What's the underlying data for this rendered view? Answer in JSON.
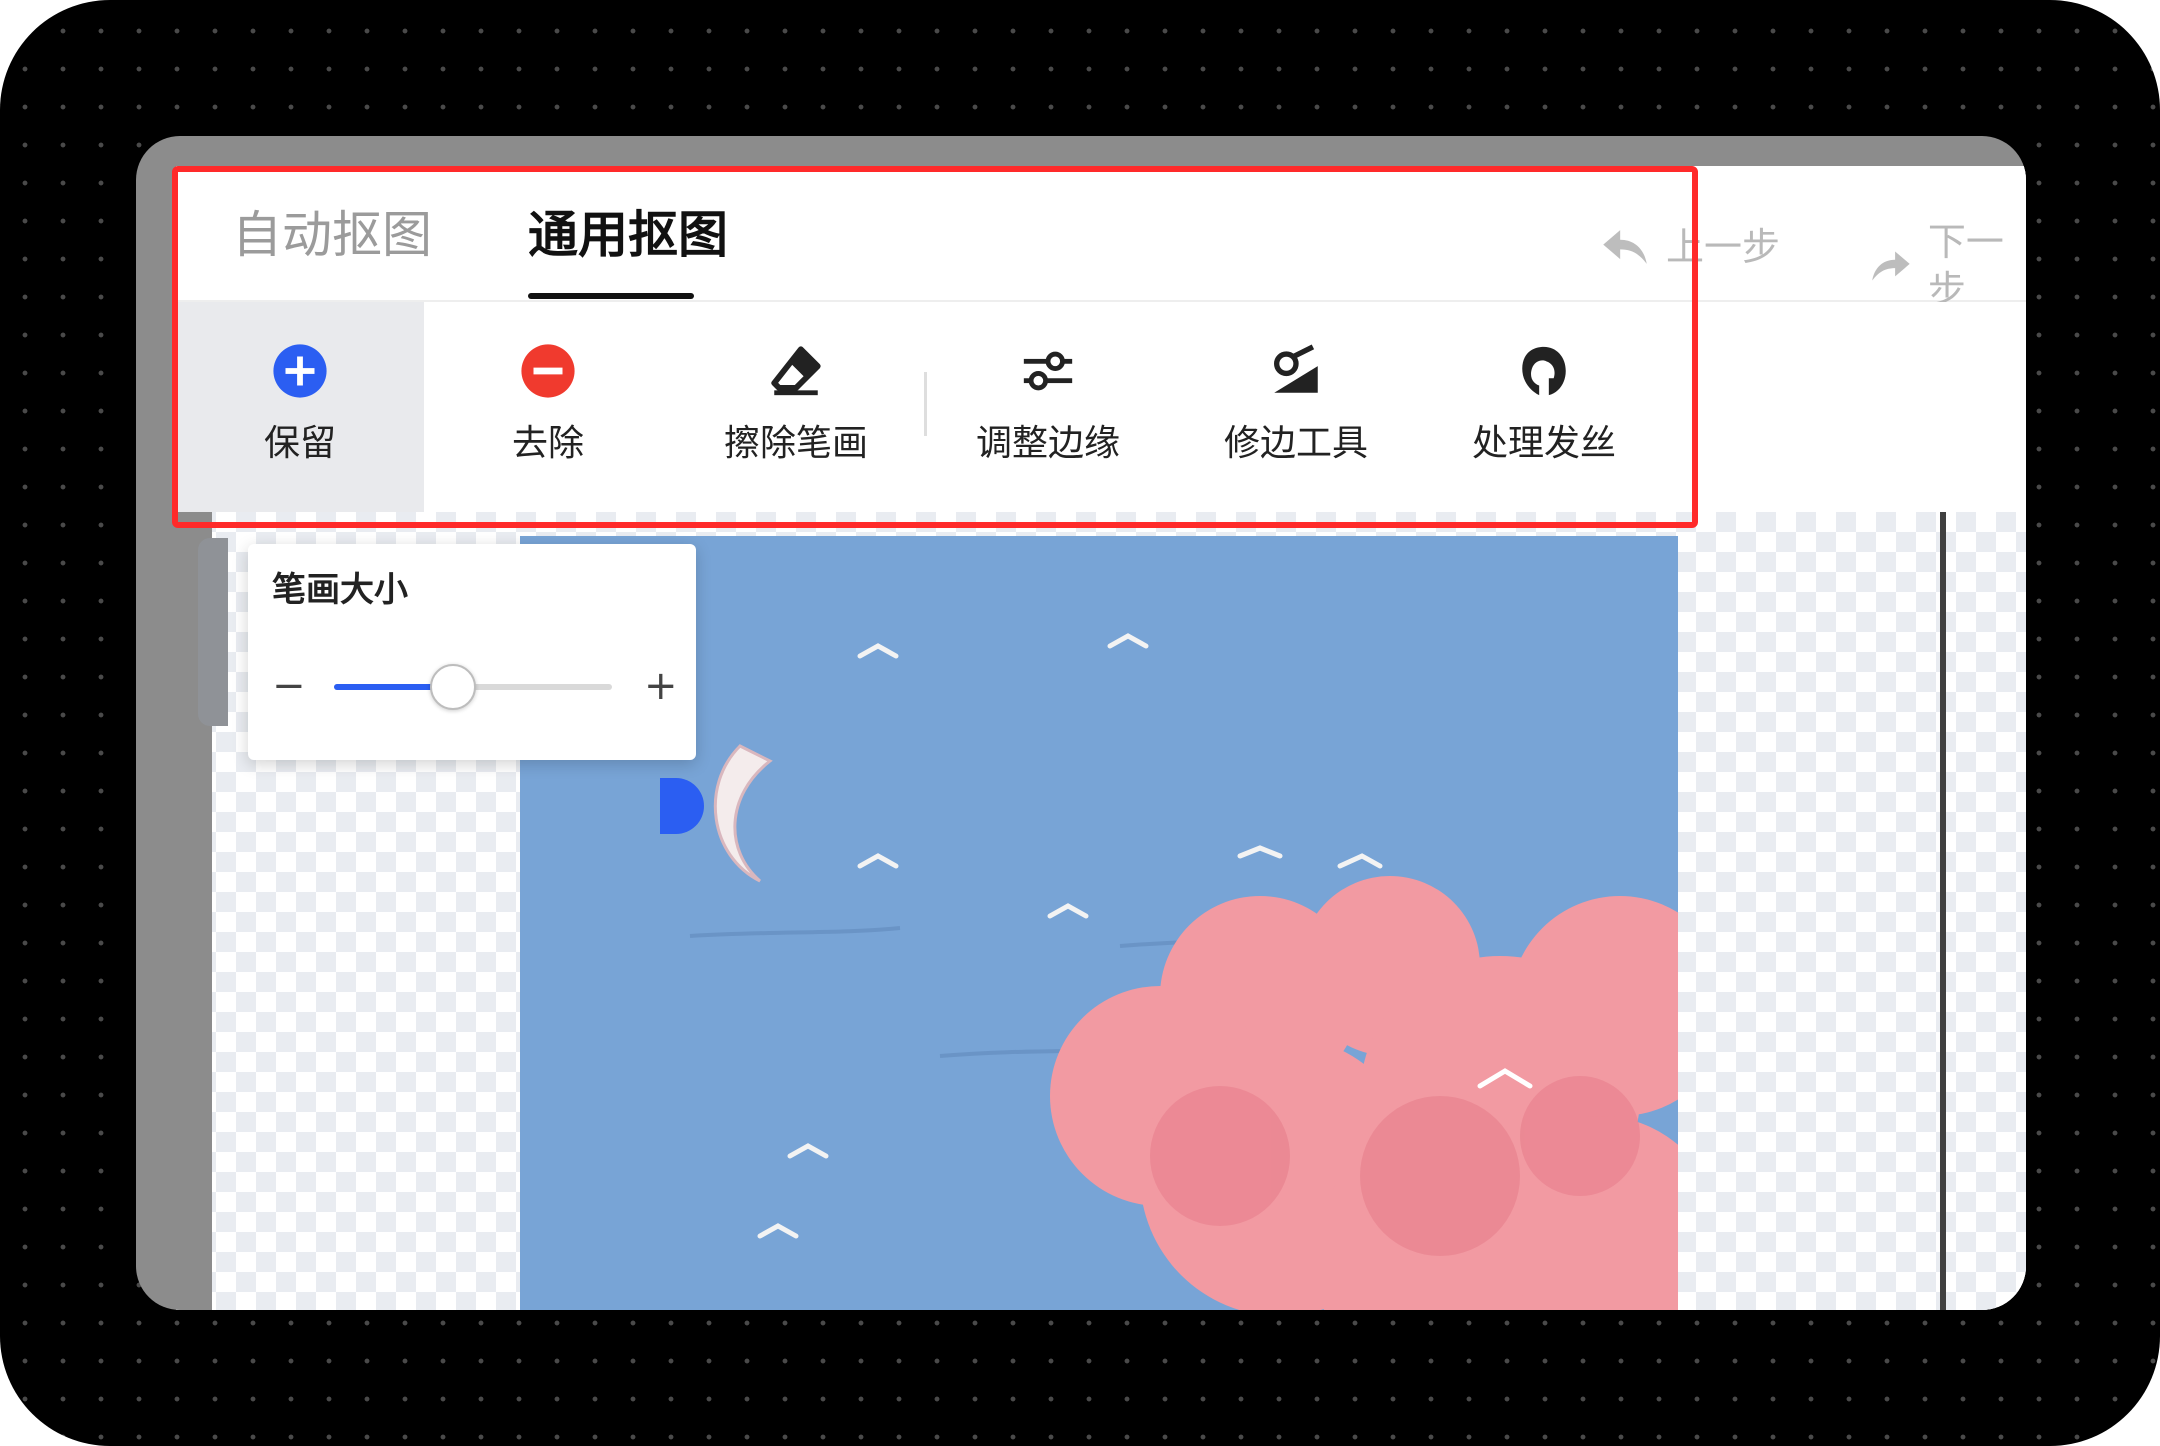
{
  "tabs": [
    {
      "label": "自动抠图",
      "active": false
    },
    {
      "label": "通用抠图",
      "active": true
    }
  ],
  "history": {
    "undo_label": "上一步",
    "redo_label": "下一步"
  },
  "tools": [
    {
      "label": "保留",
      "icon": "plus-circle-icon",
      "color": "#2b5ef2",
      "active": true
    },
    {
      "label": "去除",
      "icon": "minus-circle-icon",
      "color": "#f03a2e",
      "active": false
    },
    {
      "label": "擦除笔画",
      "icon": "eraser-icon",
      "color": "#222222",
      "active": false
    },
    {
      "label": "调整边缘",
      "icon": "sliders-icon",
      "color": "#222222",
      "active": false
    },
    {
      "label": "修边工具",
      "icon": "trim-brush-icon",
      "color": "#222222",
      "active": false
    },
    {
      "label": "处理发丝",
      "icon": "hair-head-icon",
      "color": "#222222",
      "active": false
    }
  ],
  "brush_panel": {
    "title": "笔画大小",
    "minus": "−",
    "plus": "+",
    "value_fraction": 0.42
  },
  "colors": {
    "accent": "#2b5ef2",
    "remove": "#f03a2e",
    "highlight": "#ff2a2a",
    "photo_sky": "#7aa6d6",
    "photo_cloud": "#f29aa2"
  }
}
